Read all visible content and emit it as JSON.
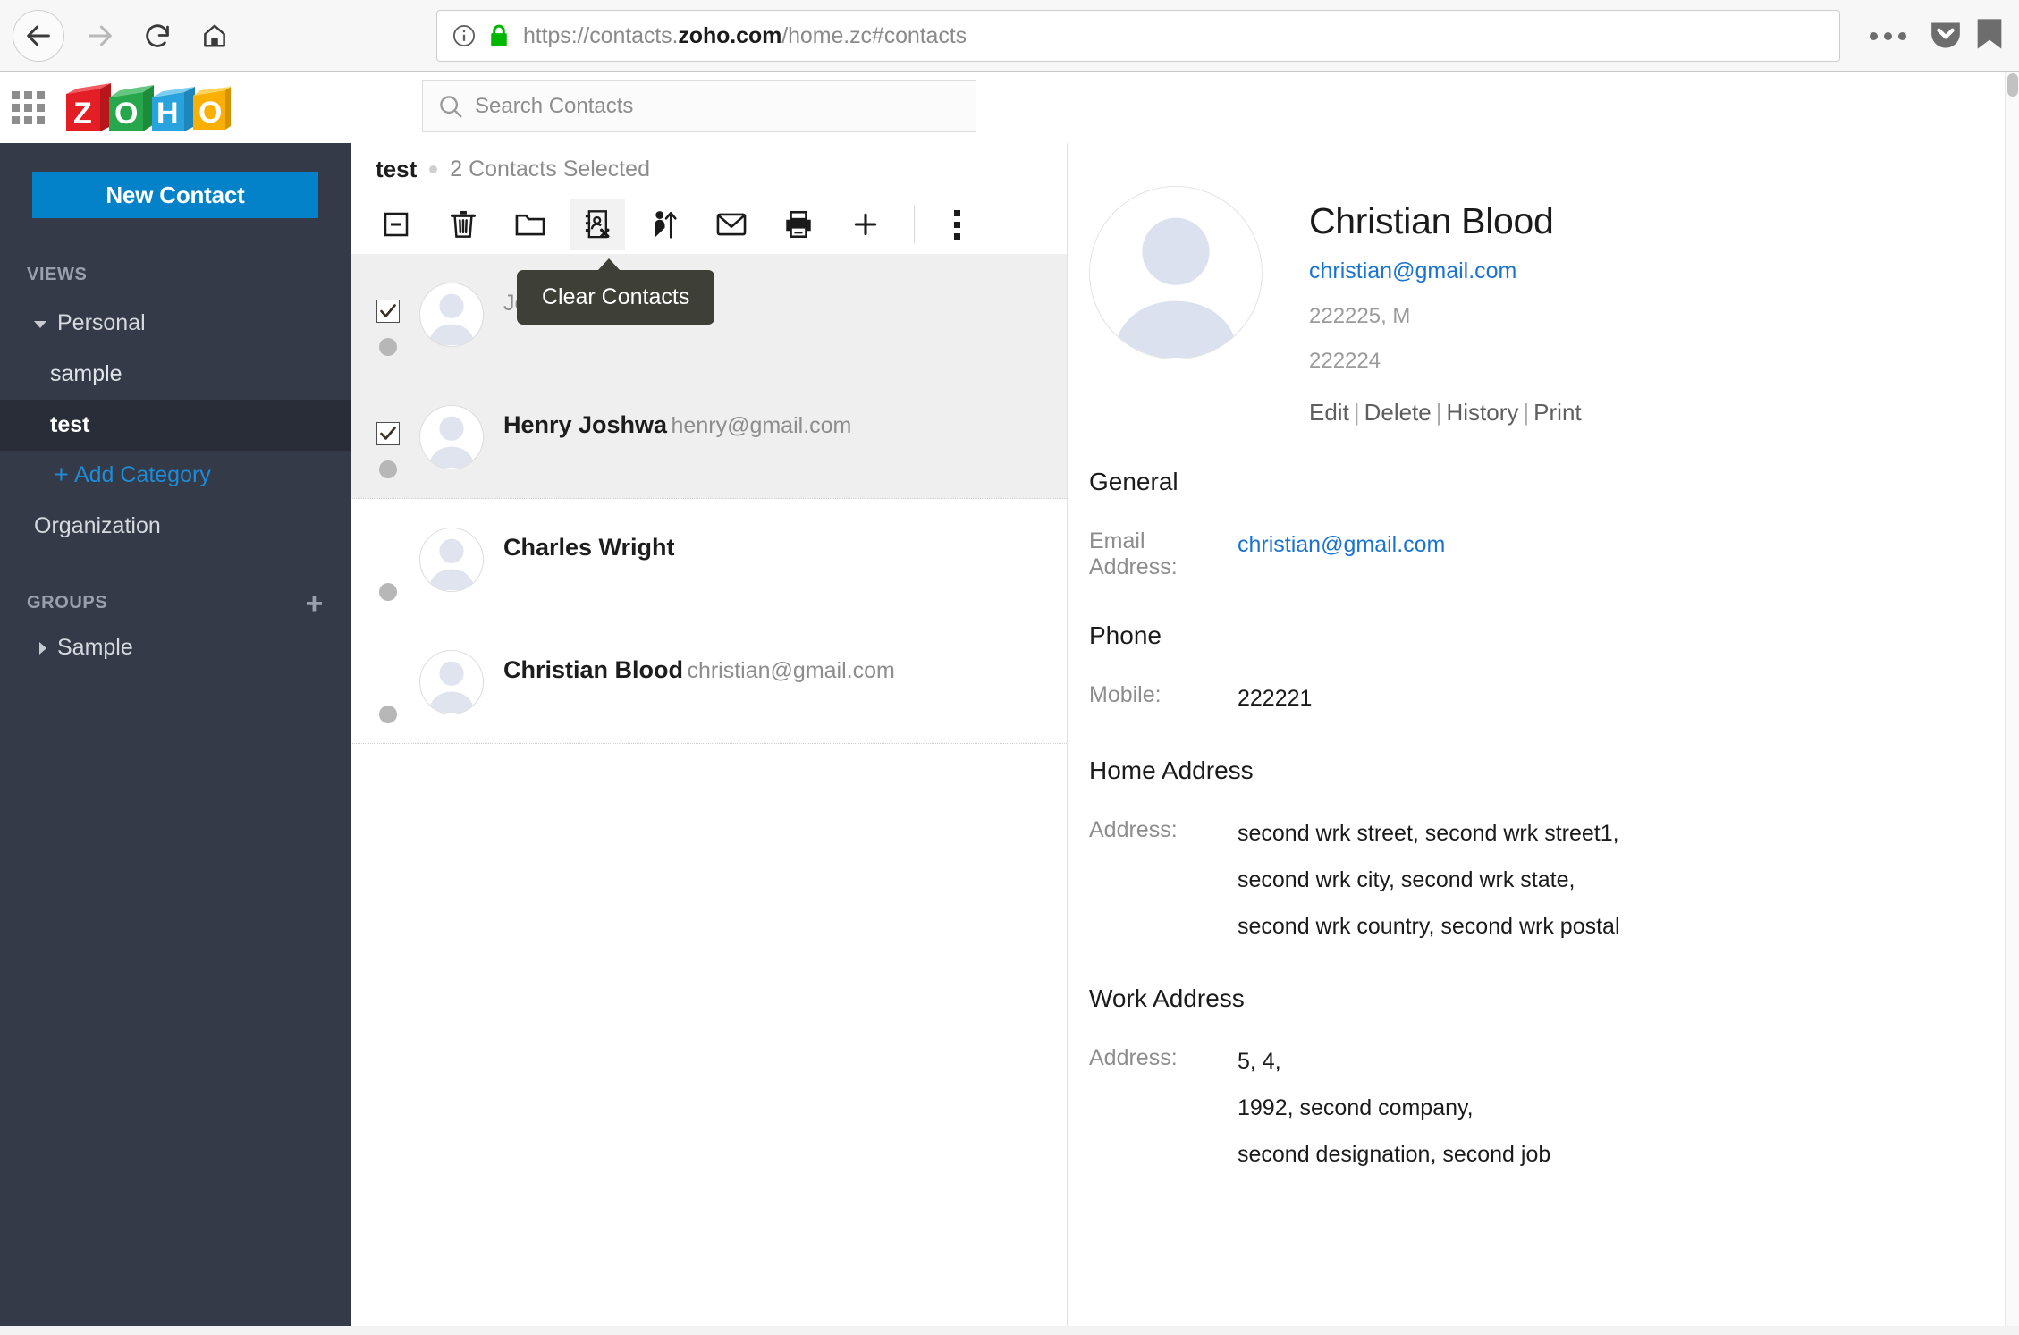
{
  "browser": {
    "back_icon": "arrow-left-icon",
    "forward_icon": "arrow-right-icon",
    "reload_icon": "reload-icon",
    "home_icon": "home-icon",
    "info_icon": "info-circle-icon",
    "lock_icon": "lock-icon",
    "url_prefix": "https://contacts.",
    "url_domain": "zoho.com",
    "url_suffix": "/home.zc#contacts",
    "menu_icon": "ellipsis-icon",
    "pocket_icon": "pocket-icon",
    "lock_color": "#00b700"
  },
  "header": {
    "app_grid_icon": "app-grid-icon",
    "logo_text": "ZOHO",
    "logo_letters": [
      "Z",
      "O",
      "H",
      "O"
    ],
    "logo_colors": [
      "#e31e24",
      "#26a74b",
      "#29a3dd",
      "#f9b000"
    ],
    "search": {
      "icon": "search-icon",
      "placeholder": "Search Contacts",
      "value": ""
    }
  },
  "sidebar": {
    "new_contact_label": "New Contact",
    "new_contact_color": "#0381c9",
    "views_heading": "VIEWS",
    "personal_label": "Personal",
    "categories": [
      {
        "label": "sample",
        "active": false
      },
      {
        "label": "test",
        "active": true
      }
    ],
    "add_category_label": "Add Category",
    "add_category_plus": "+",
    "organization_label": "Organization",
    "groups_heading": "GROUPS",
    "groups_add_icon": "plus-icon",
    "groups_add_symbol": "+",
    "group_items": [
      {
        "label": "Sample"
      }
    ]
  },
  "list": {
    "view_name": "test",
    "selection_status": "2 Contacts Selected",
    "toolbar": [
      {
        "name": "deselect-all-icon",
        "label": "Deselect All",
        "active": false
      },
      {
        "name": "delete-icon",
        "label": "Delete",
        "active": false
      },
      {
        "name": "move-to-folder-icon",
        "label": "Move to Folder",
        "active": false
      },
      {
        "name": "clear-contacts-icon",
        "label": "Clear Contacts",
        "active": true
      },
      {
        "name": "merge-contacts-icon",
        "label": "Merge Contacts",
        "active": false
      },
      {
        "name": "send-mail-icon",
        "label": "Send Mail",
        "active": false
      },
      {
        "name": "print-icon",
        "label": "Print",
        "active": false
      },
      {
        "name": "add-icon",
        "label": "Add",
        "active": false
      },
      {
        "name": "more-options-icon",
        "label": "More Options",
        "active": false
      }
    ],
    "tooltip": {
      "text": "Clear Contacts",
      "background": "#3e4038"
    },
    "contacts": [
      {
        "name": "",
        "email": "John@gmail.com",
        "checked": true,
        "selected": true,
        "name_hidden_by_tooltip": true
      },
      {
        "name": "Henry Joshwa",
        "email": "henry@gmail.com",
        "checked": true,
        "selected": true,
        "name_hidden_by_tooltip": false
      },
      {
        "name": "Charles Wright",
        "email": "",
        "checked": false,
        "selected": false,
        "name_hidden_by_tooltip": false
      },
      {
        "name": "Christian Blood",
        "email": "christian@gmail.com",
        "checked": false,
        "selected": false,
        "name_hidden_by_tooltip": false
      }
    ]
  },
  "detail": {
    "avatar_icon": "contact-avatar-placeholder",
    "name": "Christian Blood",
    "email": "christian@gmail.com",
    "meta_line_1": "222225, M",
    "meta_line_2": "222224",
    "actions": [
      {
        "label": "Edit"
      },
      {
        "label": "Delete"
      },
      {
        "label": "History"
      },
      {
        "label": "Print"
      }
    ],
    "action_separator": "|",
    "link_color": "#1a73d1",
    "sections": [
      {
        "title": "General",
        "fields": [
          {
            "label": "Email Address:",
            "lines": [
              "christian@gmail.com"
            ],
            "is_link": true
          }
        ]
      },
      {
        "title": "Phone",
        "fields": [
          {
            "label": "Mobile:",
            "lines": [
              "222221"
            ],
            "is_link": false
          }
        ]
      },
      {
        "title": "Home Address",
        "fields": [
          {
            "label": "Address:",
            "lines": [
              "second wrk street, second wrk street1,",
              "second wrk city, second wrk state,",
              "second wrk country, second wrk postal"
            ],
            "is_link": false
          }
        ]
      },
      {
        "title": "Work Address",
        "fields": [
          {
            "label": "Address:",
            "lines": [
              "5, 4,",
              "1992, second company,",
              "second designation, second job"
            ],
            "is_link": false
          }
        ]
      }
    ]
  }
}
